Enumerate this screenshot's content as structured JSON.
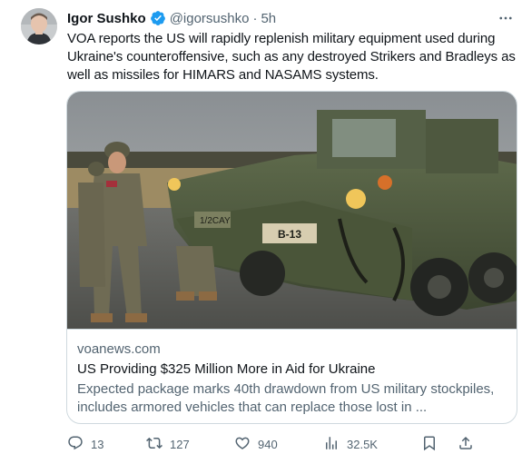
{
  "tweet": {
    "author": {
      "name": "Igor Sushko",
      "handle": "@igorsushko",
      "verified_icon": "verified-badge-icon",
      "avatar_icon": "avatar"
    },
    "separator": "·",
    "time": "5h",
    "text_lines": [
      "VOA reports the US will rapidly replenish military equipment used during",
      "Ukraine's counteroffensive, such as any destroyed Strikers and Bradleys as",
      "well as missiles for HIMARS and NASAMS systems."
    ],
    "card": {
      "image_subject": "soldiers beside an armored Stryker vehicle",
      "vehicle_plate_left": "1/2CAY",
      "vehicle_plate_center": "B-13",
      "domain": "voanews.com",
      "title": "US Providing $325 Million More in Aid for Ukraine",
      "description_lines": [
        "Expected package marks 40th drawdown from US military stockpiles,",
        "includes armored vehicles that can replace those lost in ..."
      ]
    },
    "actions": {
      "reply_count": "13",
      "retweet_count": "127",
      "like_count": "940",
      "views_count": "32.5K"
    },
    "colors": {
      "accent": "#1d9bf0",
      "secondary_text": "#536471",
      "border": "#cfd9de"
    }
  }
}
